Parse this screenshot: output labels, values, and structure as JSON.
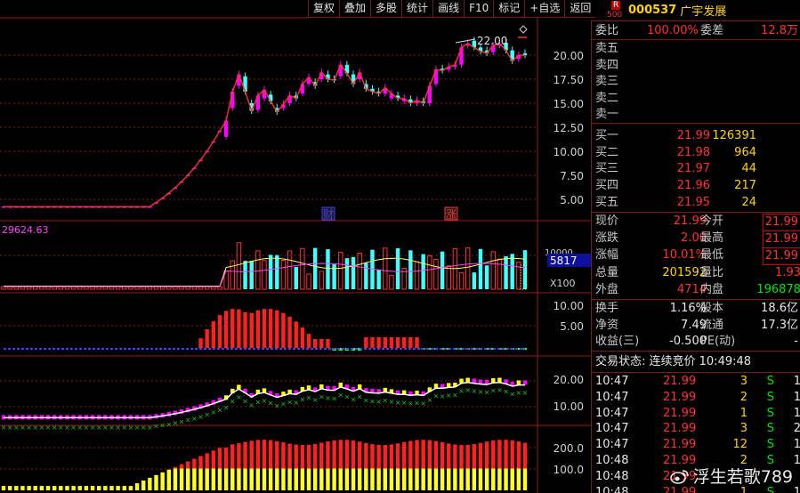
{
  "toolbar": [
    "复权",
    "叠加",
    "多股",
    "统计",
    "画线",
    "F10",
    "标记",
    "+自选",
    "返回"
  ],
  "header": {
    "badge_r": "R",
    "badge_num": "500",
    "code": "000537",
    "name": "广宇发展"
  },
  "main_chart": {
    "axis_ticks": [
      "20.00",
      "17.50",
      "15.00",
      "12.50",
      "10.00",
      "7.50",
      "5.00"
    ],
    "high_label": "22.00",
    "markers": [
      {
        "text": "财",
        "color": "#3a3aff"
      },
      {
        "text": "涨",
        "color": "#ff3030"
      }
    ]
  },
  "volume_chart": {
    "max_label": "29624.63",
    "value_label": "5817",
    "unit_label": "X100",
    "axis_tick": "10000"
  },
  "ind1_chart": {
    "axis_ticks": [
      "10.00",
      "5.00"
    ]
  },
  "ind2_chart": {
    "axis_ticks": [
      "20.00",
      "10.00"
    ]
  },
  "ind3_chart": {
    "axis_ticks": [
      "200.0",
      "100.0"
    ]
  },
  "panel": {
    "weibi_label": "委比",
    "weibi_value": "100.00%",
    "weicha_label": "委差",
    "weicha_value": "12.8万",
    "sells": [
      {
        "label": "卖五",
        "price": "",
        "vol": ""
      },
      {
        "label": "卖四",
        "price": "",
        "vol": ""
      },
      {
        "label": "卖三",
        "price": "",
        "vol": ""
      },
      {
        "label": "卖二",
        "price": "",
        "vol": ""
      },
      {
        "label": "卖一",
        "price": "",
        "vol": ""
      }
    ],
    "buys": [
      {
        "label": "买一",
        "price": "21.99",
        "vol": "126391"
      },
      {
        "label": "买二",
        "price": "21.98",
        "vol": "964"
      },
      {
        "label": "买三",
        "price": "21.97",
        "vol": "44"
      },
      {
        "label": "买四",
        "price": "21.96",
        "vol": "217"
      },
      {
        "label": "买五",
        "price": "21.95",
        "vol": "24"
      }
    ],
    "quote": [
      {
        "l1": "现价",
        "v1": "21.99",
        "c1": "red",
        "l2": "今开",
        "v2": "21.99",
        "c2": "red",
        "box2": true
      },
      {
        "l1": "涨跌",
        "v1": "2.00",
        "c1": "red",
        "l2": "最高",
        "v2": "21.99",
        "c2": "red",
        "box2": true
      },
      {
        "l1": "涨幅",
        "v1": "10.01%",
        "c1": "red",
        "l2": "最低",
        "v2": "21.99",
        "c2": "red",
        "box2": true
      },
      {
        "l1": "总量",
        "v1": "201592",
        "c1": "yel",
        "l2": "量比",
        "v2": "1.93",
        "c2": "red",
        "box2": false
      },
      {
        "l1": "外盘",
        "v1": "4714",
        "c1": "red",
        "l2": "内盘",
        "v2": "196878",
        "c2": "grn",
        "box2": false
      }
    ],
    "stats": [
      {
        "l1": "换手",
        "v1": "1.16%",
        "l2": "股本",
        "v2": "18.6亿"
      },
      {
        "l1": "净资",
        "v1": "7.49",
        "l2": "流通",
        "v2": "17.3亿"
      },
      {
        "l1": "收益(三)",
        "v1": "-0.500",
        "l2": "PE(动)",
        "v2": "-"
      }
    ],
    "trade_status": "交易状态: 连续竞价 10:49:48",
    "ticks": [
      {
        "time": "10:47",
        "price": "21.99",
        "vol": "3",
        "side": "S",
        "n": "1"
      },
      {
        "time": "10:47",
        "price": "21.99",
        "vol": "2",
        "side": "S",
        "n": "1"
      },
      {
        "time": "10:47",
        "price": "21.99",
        "vol": "1",
        "side": "S",
        "n": "1"
      },
      {
        "time": "10:47",
        "price": "21.99",
        "vol": "3",
        "side": "S",
        "n": "2"
      },
      {
        "time": "10:47",
        "price": "21.99",
        "vol": "12",
        "side": "S",
        "n": "1"
      },
      {
        "time": "10:48",
        "price": "21.99",
        "vol": "2",
        "side": "S",
        "n": "1"
      },
      {
        "time": "10:48",
        "price": "21.99",
        "vol": "",
        "side": "",
        "n": ""
      },
      {
        "time": "10:48",
        "price": "21.99",
        "vol": "1",
        "side": "S",
        "n": "1"
      }
    ]
  },
  "watermark": "浮生若歌789"
}
